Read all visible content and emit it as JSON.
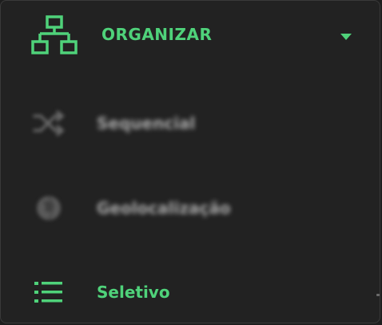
{
  "colors": {
    "accent": "#4fd27a",
    "background": "#222222",
    "muted_text": "#a8a8a8",
    "muted_icon": "#6a6a6a"
  },
  "menu": {
    "header": {
      "title": "ORGANIZAR",
      "icon": "sitemap-icon",
      "caret_icon": "caret-down-icon"
    },
    "items": [
      {
        "label": "Sequencial",
        "icon": "shuffle-icon",
        "state": "blurred"
      },
      {
        "label": "Geolocalização",
        "icon": "globe-icon",
        "state": "blurred"
      },
      {
        "label": "Seletivo",
        "icon": "list-icon",
        "state": "active"
      }
    ]
  }
}
